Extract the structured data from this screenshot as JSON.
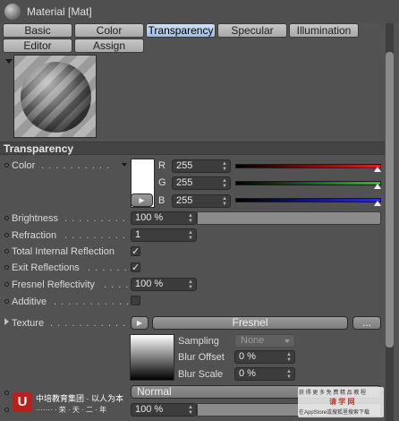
{
  "window": {
    "title": "Material [Mat]"
  },
  "tabs": [
    {
      "label": "Basic",
      "active": false
    },
    {
      "label": "Color",
      "active": false
    },
    {
      "label": "Transparency",
      "active": true
    },
    {
      "label": "Specular",
      "active": false
    },
    {
      "label": "Illumination",
      "active": false
    },
    {
      "label": "Editor",
      "active": false
    },
    {
      "label": "Assign",
      "active": false
    }
  ],
  "section": {
    "title": "Transparency"
  },
  "color": {
    "label": "Color",
    "leader": ". . . . . . . . . . . . . .",
    "swatch_hex": "#ffffff",
    "channels": [
      {
        "letter": "R",
        "value": "255"
      },
      {
        "letter": "G",
        "value": "255"
      },
      {
        "letter": "B",
        "value": "255"
      }
    ]
  },
  "brightness": {
    "label": "Brightness",
    "leader": ". . . . . . . . . . . .",
    "value": "100 %",
    "level_percent": 100
  },
  "refraction": {
    "label": "Refraction",
    "leader": ". . . . . . . . . . . .",
    "value": "1"
  },
  "total_internal_reflection": {
    "label": "Total Internal Reflection",
    "checked": true,
    "check_glyph": "✓"
  },
  "exit_reflections": {
    "label": "Exit Reflections",
    "leader": ". . . . . . .",
    "checked": true,
    "check_glyph": "✓"
  },
  "fresnel_reflectivity": {
    "label": "Fresnel Reflectivity",
    "leader": ". . . . .",
    "value": "100 %"
  },
  "additive": {
    "label": "Additive",
    "leader": ". . . . . . . . . . . . .",
    "checked": false,
    "check_glyph": ""
  },
  "texture": {
    "label": "Texture",
    "leader": ". . . . . . . . . . . . . . .",
    "shader_name": "Fresnel",
    "more_label": "..."
  },
  "sampling": {
    "label": "Sampling",
    "value": "None"
  },
  "blur_offset": {
    "label": "Blur Offset",
    "value": "0 %"
  },
  "blur_scale": {
    "label": "Blur Scale",
    "value": "0 %"
  },
  "mix_mode": {
    "value": "Normal"
  },
  "mix_strength": {
    "value": "100 %"
  },
  "watermark": {
    "logo_letter": "U",
    "text_left": "中培教育集团 · 以人为本",
    "text_left2": "·······  · 荣 · 天 · 二 · 年",
    "text_right": "获 得 更 多 免 费 精 品 教 程",
    "text_right2": "请 学 网",
    "text_right3": "在AppStore或搜狐里搜索下载"
  },
  "colors": {
    "background": "#525252",
    "tab_active": "#9fbde0",
    "red_channel": "#e02020",
    "green_channel": "#2ec02e",
    "blue_channel": "#2030e0"
  }
}
